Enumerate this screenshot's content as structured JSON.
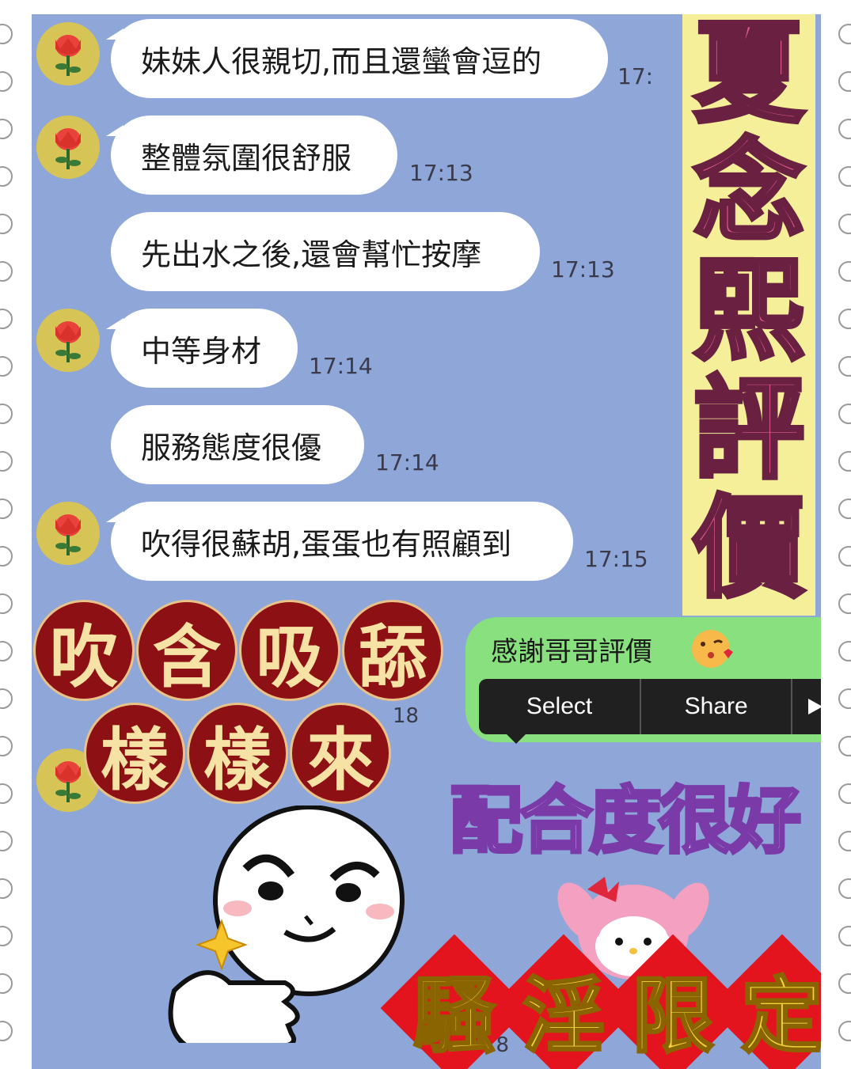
{
  "messages": [
    {
      "text": "妹妹人很親切,而且還蠻會逗的",
      "time": "17:"
    },
    {
      "text": "整體氛圍很舒服",
      "time": "17:13"
    },
    {
      "text": "先出水之後,還會幫忙按摩",
      "time": "17:13"
    },
    {
      "text": "中等身材",
      "time": "17:14"
    },
    {
      "text": "服務態度很優",
      "time": "17:14"
    },
    {
      "text": "吹得很蘇胡,蛋蛋也有照顧到",
      "time": "17:15"
    }
  ],
  "title_chars": [
    "夏",
    "念",
    "熙",
    "評",
    "價"
  ],
  "reply": {
    "text": "感謝哥哥評價",
    "time": "18"
  },
  "context_menu": {
    "select": "Select",
    "share": "Share",
    "more_icon": "play-triangle"
  },
  "coins_row1": [
    "吹",
    "含",
    "吸",
    "舔"
  ],
  "coins_row2": [
    "樣",
    "樣",
    "來"
  ],
  "cooperation_text": "配合度很好",
  "diamond_chars": [
    "騷",
    "淫",
    "限",
    "定"
  ],
  "bottom_time": "18",
  "colors": {
    "chat_bg": "#8ea6d8",
    "reply_bubble": "#88e07e",
    "title_pink": "#e25a94",
    "title_bg": "#f4ef98",
    "coin": "#8d1014",
    "diamond": "#e3141d"
  }
}
